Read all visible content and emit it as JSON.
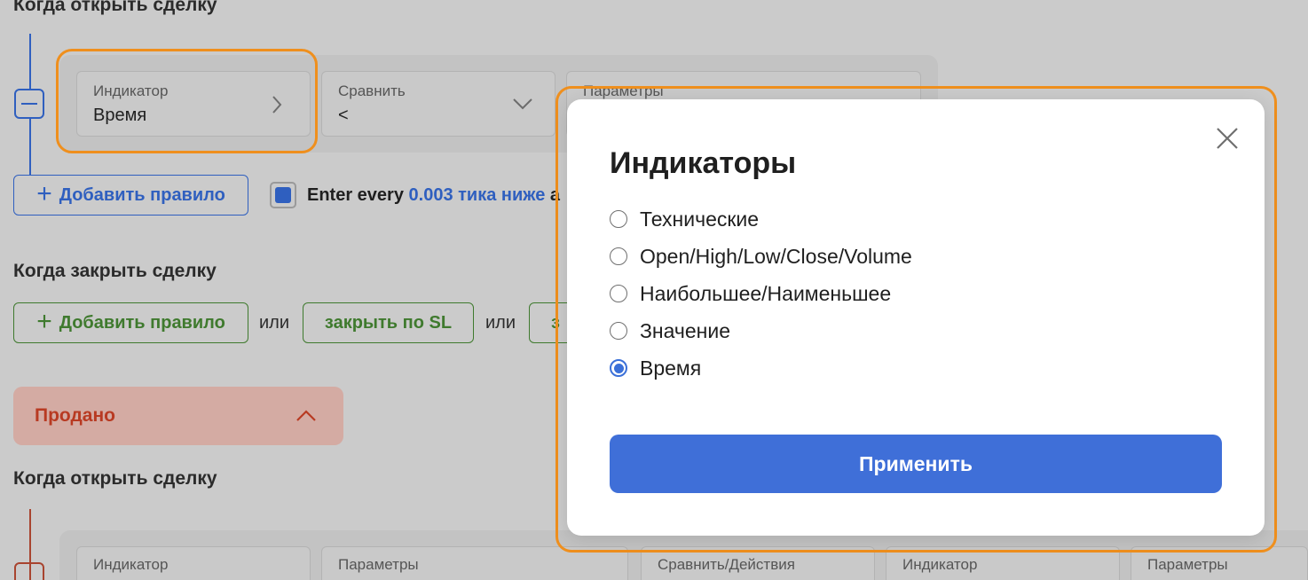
{
  "open_section": {
    "title": "Когда открыть сделку",
    "rule": {
      "indicator_label": "Индикатор",
      "indicator_value": "Время",
      "compare_label": "Сравнить",
      "compare_value": "<",
      "params_label": "Параметры"
    },
    "add_rule_label": "Добавить правило",
    "enter_text_prefix": "Enter every",
    "enter_link": "0.003 тика ниже",
    "enter_text_suffix": "а"
  },
  "close_section": {
    "title": "Когда закрыть сделку",
    "add_rule_label": "Добавить правило",
    "or_1": "или",
    "close_sl_label": "закрыть по SL",
    "or_2": "или",
    "partial_button_label": "з"
  },
  "sold_panel": {
    "label": "Продано"
  },
  "open_section_2": {
    "title": "Когда открыть сделку",
    "fields": [
      "Индикатор",
      "Параметры",
      "Сравнить/Действия",
      "Индикатор",
      "Параметры"
    ]
  },
  "modal": {
    "title": "Индикаторы",
    "options": [
      {
        "label": "Технические",
        "checked": false
      },
      {
        "label": "Open/High/Low/Close/Volume",
        "checked": false
      },
      {
        "label": "Наибольшее/Наименьшее",
        "checked": false
      },
      {
        "label": "Значение",
        "checked": false
      },
      {
        "label": "Время",
        "checked": true
      }
    ],
    "apply_label": "Применить"
  },
  "colors": {
    "accent_blue": "#3f6fd8",
    "highlight_orange": "#ef8f1d",
    "sold_red": "#b83a22",
    "green": "#3f7a2e"
  }
}
